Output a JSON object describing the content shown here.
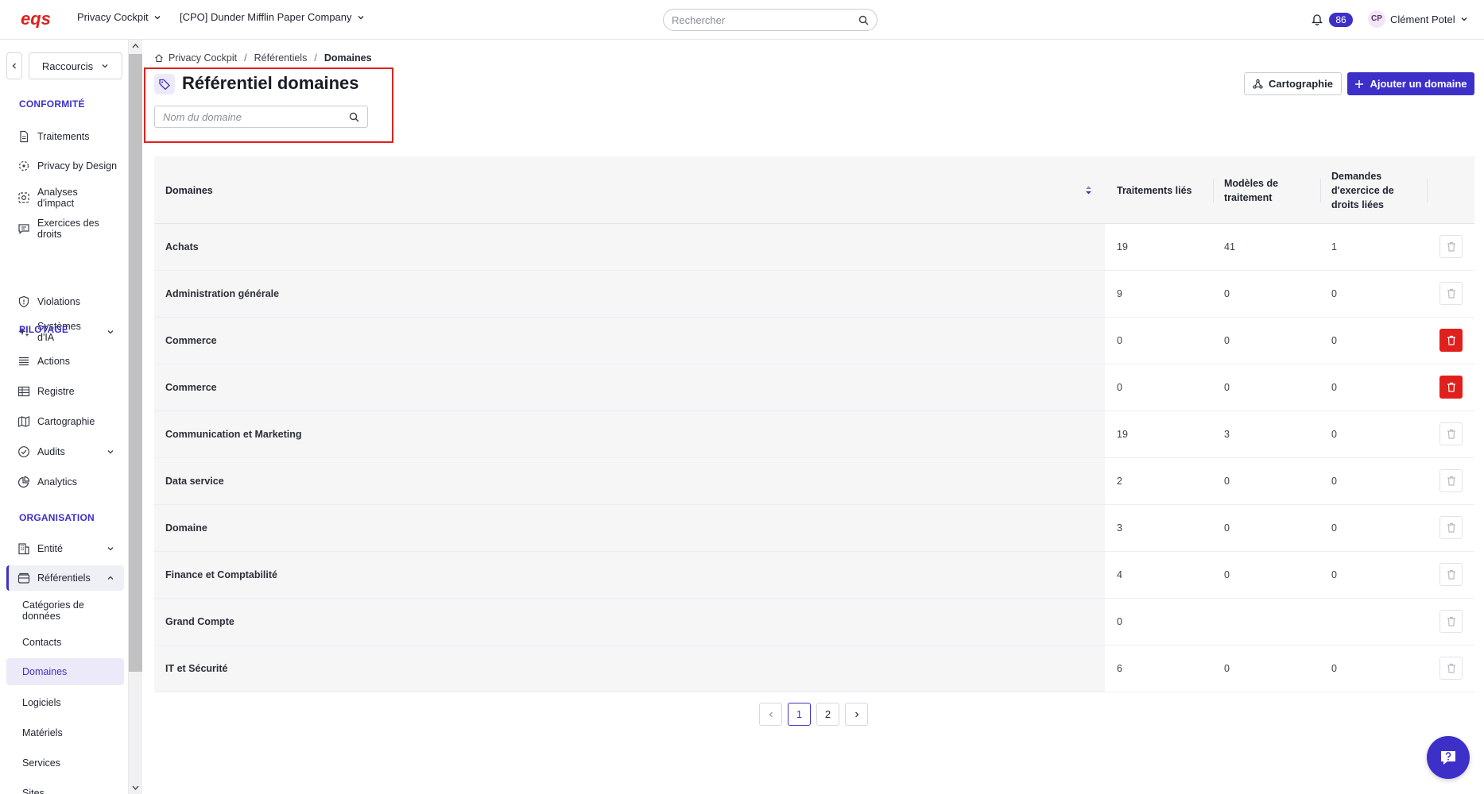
{
  "topbar": {
    "logo": "eqs",
    "app_menu": "Privacy Cockpit",
    "company_menu": "[CPO] Dunder Mifflin Paper Company",
    "search_placeholder": "Rechercher",
    "notifications_count": "86",
    "user_initials": "CP",
    "user_name": "Clément Potel"
  },
  "sidebar": {
    "shortcuts_label": "Raccourcis",
    "sections": {
      "conformite": "CONFORMITÉ",
      "pilotage": "PILOTAGE",
      "organisation": "ORGANISATION"
    },
    "items": {
      "traitements": "Traitements",
      "privacy_by_design": "Privacy by Design",
      "analyses": "Analyses d'impact",
      "exercices": "Exercices des droits",
      "violations": "Violations",
      "systemes_ia": "Systèmes d'IA",
      "actions": "Actions",
      "registre": "Registre",
      "cartographie": "Cartographie",
      "audits": "Audits",
      "analytics": "Analytics",
      "entite": "Entité",
      "referentiels": "Référentiels"
    },
    "subitems": {
      "categories": "Catégories de données",
      "contacts": "Contacts",
      "domaines": "Domaines",
      "logiciels": "Logiciels",
      "materiels": "Matériels",
      "services": "Services",
      "sites": "Sites"
    }
  },
  "breadcrumb": {
    "home": "Privacy Cockpit",
    "level2": "Référentiels",
    "current": "Domaines"
  },
  "page": {
    "title": "Référentiel domaines",
    "search_placeholder": "Nom du domaine",
    "btn_cartographie": "Cartographie",
    "btn_add": "Ajouter un domaine"
  },
  "table": {
    "headers": {
      "domaines": "Domaines",
      "traitements": "Traitements liés",
      "modeles": "Modèles de traitement",
      "demandes": "Demandes d'exercice de droits liées"
    },
    "rows": [
      {
        "name": "Achats",
        "traitements": "19",
        "modeles": "41",
        "demandes": "1",
        "deletable": false
      },
      {
        "name": "Administration générale",
        "traitements": "9",
        "modeles": "0",
        "demandes": "0",
        "deletable": false
      },
      {
        "name": "Commerce",
        "traitements": "0",
        "modeles": "0",
        "demandes": "0",
        "deletable": true
      },
      {
        "name": "Commerce",
        "traitements": "0",
        "modeles": "0",
        "demandes": "0",
        "deletable": true
      },
      {
        "name": "Communication et Marketing",
        "traitements": "19",
        "modeles": "3",
        "demandes": "0",
        "deletable": false
      },
      {
        "name": "Data service",
        "traitements": "2",
        "modeles": "0",
        "demandes": "0",
        "deletable": false
      },
      {
        "name": "Domaine",
        "traitements": "3",
        "modeles": "0",
        "demandes": "0",
        "deletable": false
      },
      {
        "name": "Finance et Comptabilité",
        "traitements": "4",
        "modeles": "0",
        "demandes": "0",
        "deletable": false
      },
      {
        "name": "Grand Compte",
        "traitements": "0",
        "modeles": "",
        "demandes": "",
        "deletable": false
      },
      {
        "name": "IT et Sécurité",
        "traitements": "6",
        "modeles": "0",
        "demandes": "0",
        "deletable": false
      }
    ]
  },
  "pagination": {
    "pages": [
      "1",
      "2"
    ],
    "current": "1"
  },
  "colors": {
    "accent": "#3d30c9",
    "logo": "#e0201d",
    "danger": "#e0201d",
    "highlight_box": "#e0201d"
  }
}
